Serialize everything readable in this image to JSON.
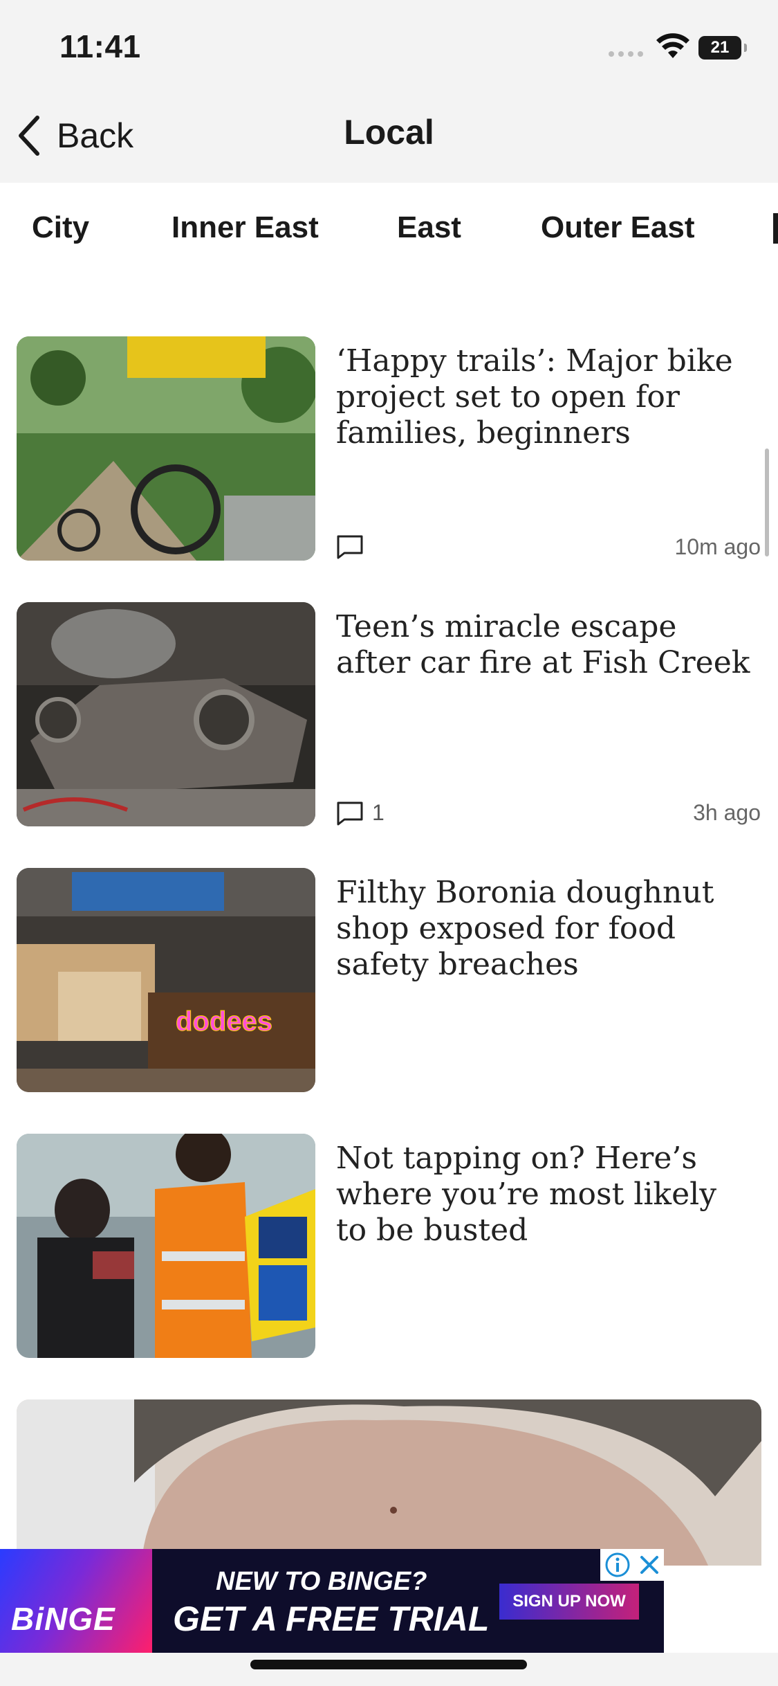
{
  "status_bar": {
    "time": "11:41",
    "battery": "21"
  },
  "nav": {
    "back_label": "Back",
    "title": "Local"
  },
  "tabs": [
    "City",
    "Inner East",
    "East",
    "Outer East"
  ],
  "articles": [
    {
      "headline": "‘Happy trails’: Major bike project set to open for families, beginners",
      "comments": "",
      "time": "10m  ago",
      "image": "mountain-bike-riders"
    },
    {
      "headline": "Teen’s miracle escape after car fire at Fish Creek",
      "comments": "1",
      "time": "3h  ago",
      "image": "burnt-car-wreck"
    },
    {
      "headline": "Filthy Boronia doughnut shop exposed for food safety breaches",
      "comments": "",
      "time": "",
      "image": "doughnut-shop-counter"
    },
    {
      "headline": "Not tapping on? Here’s where you’re most likely to be busted",
      "comments": "",
      "time": "",
      "image": "ticket-inspectors-myki-reader"
    }
  ],
  "ad": {
    "brand": "BiNGE",
    "line1": "NEW TO BINGE?",
    "line2": "GET A FREE TRIAL",
    "cta": "SIGN UP NOW"
  },
  "colors": {
    "bar_bg": "#f3f3f3",
    "ad_bg": "#0e0d2b",
    "ad_cta": "#c4217a",
    "info_blue": "#1b8fd6"
  }
}
